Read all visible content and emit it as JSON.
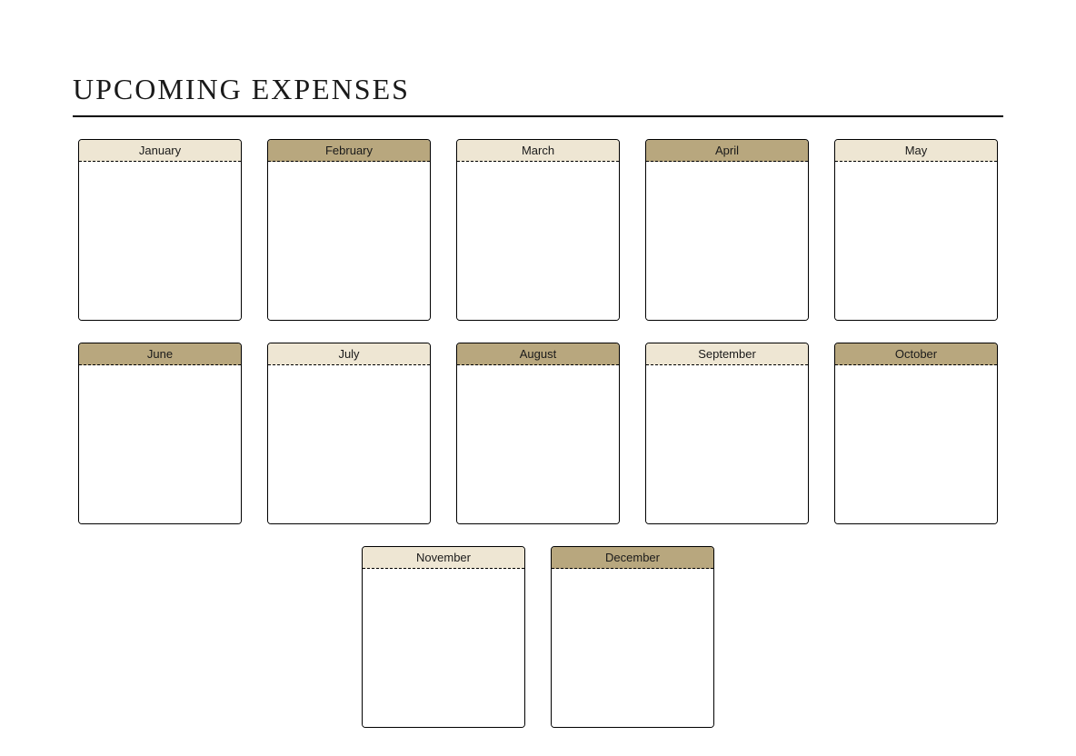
{
  "title": "UPCOMING EXPENSES",
  "months": [
    {
      "label": "January",
      "shade": "light"
    },
    {
      "label": "February",
      "shade": "dark"
    },
    {
      "label": "March",
      "shade": "light"
    },
    {
      "label": "April",
      "shade": "dark"
    },
    {
      "label": "May",
      "shade": "light"
    },
    {
      "label": "June",
      "shade": "dark"
    },
    {
      "label": "July",
      "shade": "light"
    },
    {
      "label": "August",
      "shade": "dark"
    },
    {
      "label": "September",
      "shade": "light"
    },
    {
      "label": "October",
      "shade": "dark"
    },
    {
      "label": "November",
      "shade": "light"
    },
    {
      "label": "December",
      "shade": "dark"
    }
  ],
  "colors": {
    "light": "#eee6d3",
    "dark": "#b8a77e",
    "border": "#000000"
  }
}
